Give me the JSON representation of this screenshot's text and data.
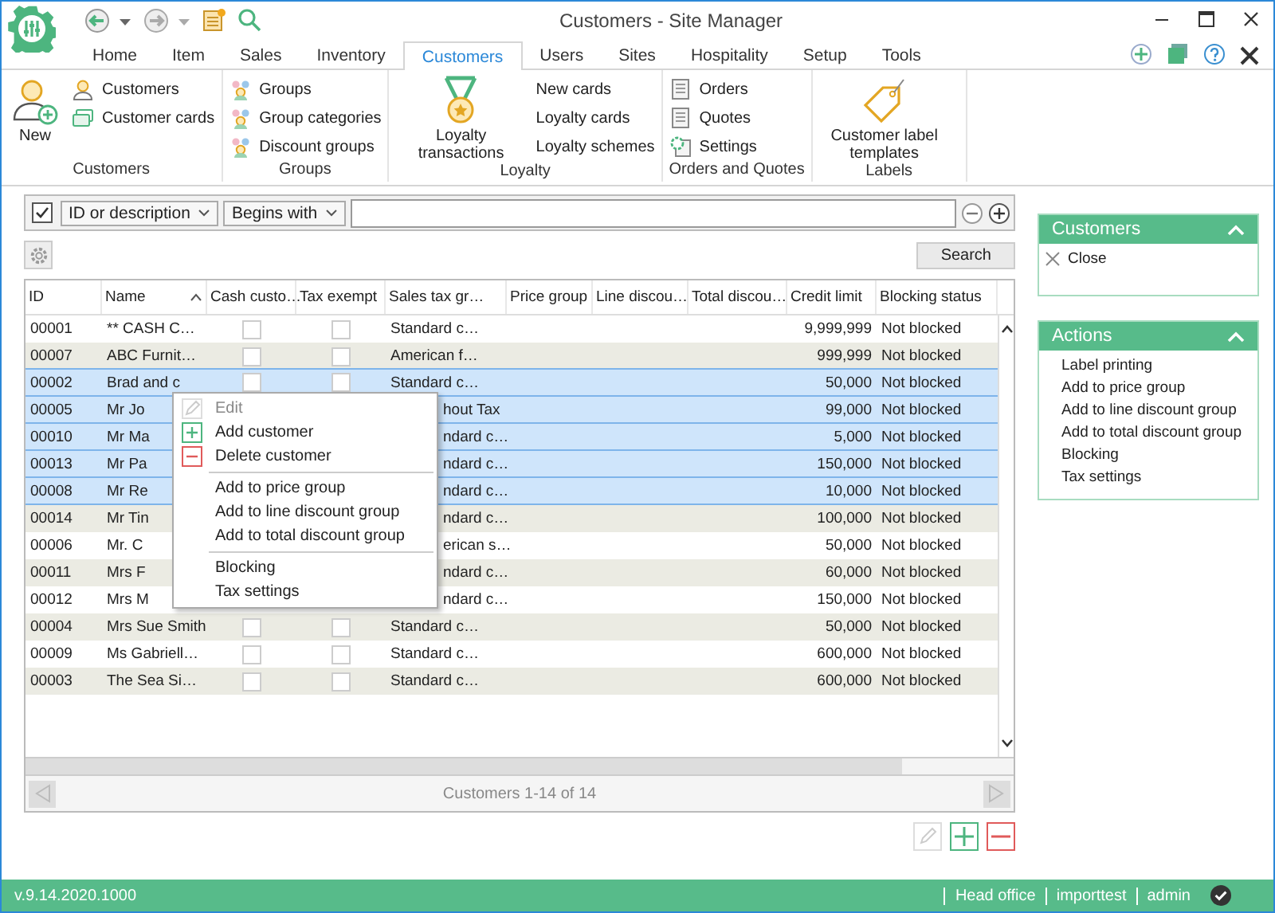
{
  "window": {
    "title": "Customers - Site Manager"
  },
  "menu_tabs": [
    {
      "label": "Home",
      "selected": false
    },
    {
      "label": "Item",
      "selected": false
    },
    {
      "label": "Sales",
      "selected": false
    },
    {
      "label": "Inventory",
      "selected": false
    },
    {
      "label": "Customers",
      "selected": true
    },
    {
      "label": "Users",
      "selected": false
    },
    {
      "label": "Sites",
      "selected": false
    },
    {
      "label": "Hospitality",
      "selected": false
    },
    {
      "label": "Setup",
      "selected": false
    },
    {
      "label": "Tools",
      "selected": false
    }
  ],
  "ribbon_groups": [
    {
      "label": "Customers",
      "items": [
        {
          "label": "New",
          "kind": "large"
        },
        {
          "label": "Customers",
          "kind": "small"
        },
        {
          "label": "Customer cards",
          "kind": "small"
        }
      ]
    },
    {
      "label": "Groups",
      "items": [
        {
          "label": "Groups",
          "kind": "small"
        },
        {
          "label": "Group categories",
          "kind": "small"
        },
        {
          "label": "Discount groups",
          "kind": "small"
        }
      ]
    },
    {
      "label": "Loyalty",
      "items": [
        {
          "label": "Loyalty transactions",
          "kind": "large"
        },
        {
          "label": "New cards",
          "kind": "text"
        },
        {
          "label": "Loyalty cards",
          "kind": "text"
        },
        {
          "label": "Loyalty schemes",
          "kind": "text"
        }
      ]
    },
    {
      "label": "Orders and Quotes",
      "items": [
        {
          "label": "Orders",
          "kind": "small"
        },
        {
          "label": "Quotes",
          "kind": "small"
        },
        {
          "label": "Settings",
          "kind": "small"
        }
      ]
    },
    {
      "label": "Labels",
      "items": [
        {
          "label": "Customer label templates",
          "kind": "large"
        }
      ]
    }
  ],
  "filter": {
    "enabled": true,
    "field": "ID or description",
    "operator": "Begins with"
  },
  "search_button": "Search",
  "table": {
    "columns": [
      "ID",
      "Name",
      "Cash custo…",
      "Tax exempt",
      "Sales tax gr…",
      "Price group",
      "Line discou…",
      "Total discou…",
      "Credit limit",
      "Blocking status"
    ],
    "rows": [
      {
        "id": "00001",
        "name": "** CASH C…",
        "cash_customer": false,
        "tax_exempt": false,
        "sales_tax_group": "Standard c…",
        "credit_limit": "9,999,999",
        "blocking_status": "Not blocked",
        "selected": false
      },
      {
        "id": "00007",
        "name": "ABC Furnit…",
        "cash_customer": false,
        "tax_exempt": false,
        "sales_tax_group": "American f…",
        "credit_limit": "999,999",
        "blocking_status": "Not blocked",
        "selected": false
      },
      {
        "id": "00002",
        "name": "Brad and c",
        "cash_customer": false,
        "tax_exempt": false,
        "sales_tax_group": "Standard c…",
        "credit_limit": "50,000",
        "blocking_status": "Not blocked",
        "selected": true
      },
      {
        "id": "00005",
        "name": "Mr Jo",
        "sales_tax_group": "hout Tax",
        "credit_limit": "99,000",
        "blocking_status": "Not blocked",
        "selected": true
      },
      {
        "id": "00010",
        "name": "Mr Ma",
        "sales_tax_group": "ndard c…",
        "credit_limit": "5,000",
        "blocking_status": "Not blocked",
        "selected": true
      },
      {
        "id": "00013",
        "name": "Mr Pa",
        "sales_tax_group": "ndard c…",
        "credit_limit": "150,000",
        "blocking_status": "Not blocked",
        "selected": true
      },
      {
        "id": "00008",
        "name": "Mr Re",
        "sales_tax_group": "ndard c…",
        "credit_limit": "10,000",
        "blocking_status": "Not blocked",
        "selected": true
      },
      {
        "id": "00014",
        "name": "Mr Tin",
        "sales_tax_group": "ndard c…",
        "credit_limit": "100,000",
        "blocking_status": "Not blocked",
        "selected": false
      },
      {
        "id": "00006",
        "name": "Mr. C",
        "sales_tax_group": "erican s…",
        "credit_limit": "50,000",
        "blocking_status": "Not blocked",
        "selected": false
      },
      {
        "id": "00011",
        "name": "Mrs F",
        "sales_tax_group": "ndard c…",
        "credit_limit": "60,000",
        "blocking_status": "Not blocked",
        "selected": false
      },
      {
        "id": "00012",
        "name": "Mrs M",
        "sales_tax_group": "ndard c…",
        "credit_limit": "150,000",
        "blocking_status": "Not blocked",
        "selected": false
      },
      {
        "id": "00004",
        "name": "Mrs Sue Smith",
        "cash_customer": false,
        "tax_exempt": false,
        "sales_tax_group": "Standard c…",
        "credit_limit": "50,000",
        "blocking_status": "Not blocked",
        "selected": false
      },
      {
        "id": "00009",
        "name": "Ms Gabriell…",
        "cash_customer": false,
        "tax_exempt": false,
        "sales_tax_group": "Standard c…",
        "credit_limit": "600,000",
        "blocking_status": "Not blocked",
        "selected": false
      },
      {
        "id": "00003",
        "name": "The Sea Si…",
        "cash_customer": false,
        "tax_exempt": false,
        "sales_tax_group": "Standard c…",
        "credit_limit": "600,000",
        "blocking_status": "Not blocked",
        "selected": false
      }
    ]
  },
  "pager": "Customers 1-14 of 14",
  "context_menu": [
    {
      "label": "Edit",
      "kind": "item",
      "disabled": true
    },
    {
      "label": "Add customer",
      "kind": "item",
      "disabled": false
    },
    {
      "label": "Delete customer",
      "kind": "item",
      "disabled": false
    },
    {
      "kind": "separator"
    },
    {
      "label": "Add to price group",
      "kind": "item",
      "disabled": false
    },
    {
      "label": "Add to line discount group",
      "kind": "item",
      "disabled": false
    },
    {
      "label": "Add to total discount group",
      "kind": "item",
      "disabled": false
    },
    {
      "kind": "separator"
    },
    {
      "label": "Blocking",
      "kind": "item",
      "disabled": false
    },
    {
      "label": "Tax settings",
      "kind": "item",
      "disabled": false
    }
  ],
  "record_buttons": {
    "edit_disabled": true
  },
  "side_panels": [
    {
      "title": "Customers",
      "expanded": true,
      "items": [
        {
          "label": "Close",
          "kind": "close"
        }
      ]
    },
    {
      "title": "Actions",
      "expanded": true,
      "items": [
        {
          "label": "Label printing",
          "kind": "link"
        },
        {
          "label": "Add to price group",
          "kind": "link"
        },
        {
          "label": "Add to line discount group",
          "kind": "link"
        },
        {
          "label": "Add to total discount group",
          "kind": "link"
        },
        {
          "label": "Blocking",
          "kind": "link"
        },
        {
          "label": "Tax settings",
          "kind": "link"
        }
      ]
    }
  ],
  "status_bar": {
    "version": "v.9.14.2020.1000",
    "items": [
      "Head office",
      "importtest",
      "admin"
    ]
  }
}
